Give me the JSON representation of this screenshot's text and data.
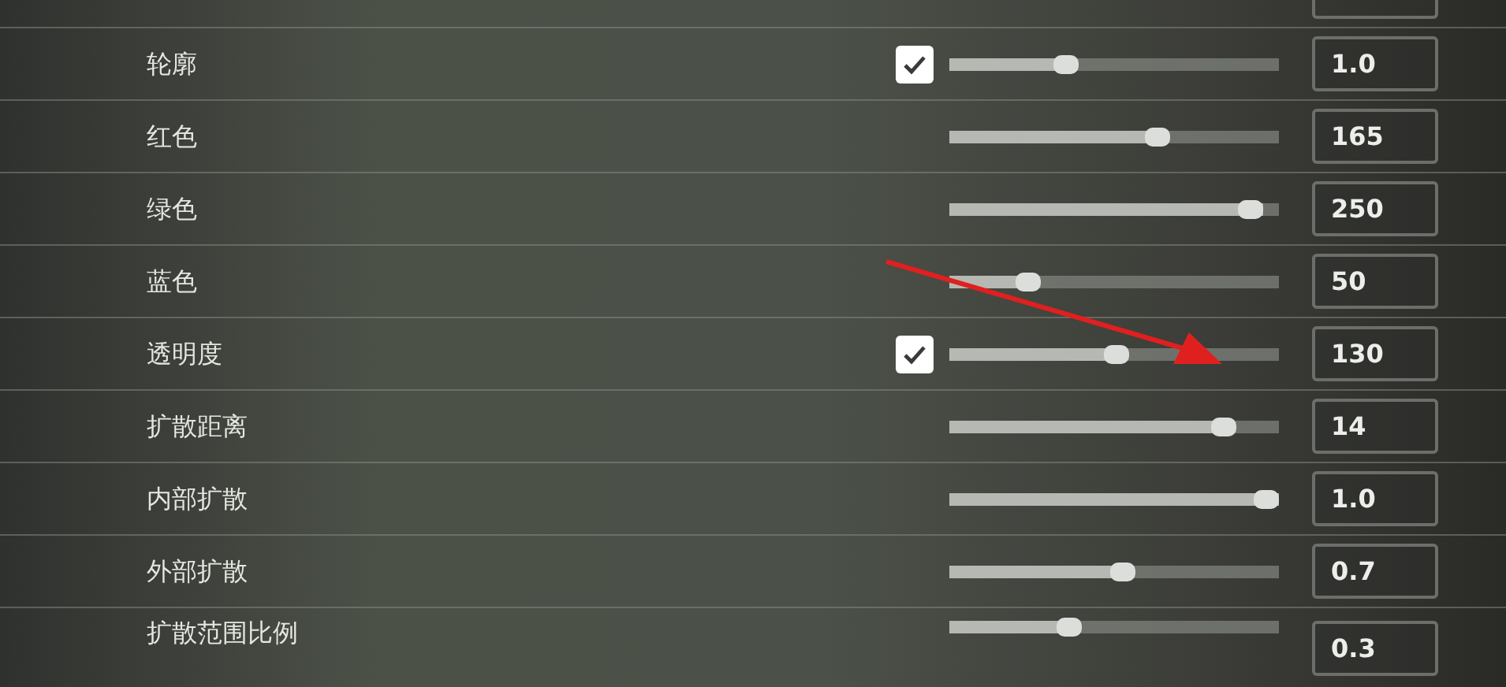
{
  "rows": [
    {
      "kind": "checkbox-slider",
      "label": "轮廓",
      "checked": true,
      "level": 0.34,
      "value": "1.0"
    },
    {
      "kind": "slider",
      "label": "红色",
      "level": 0.64,
      "value": "165"
    },
    {
      "kind": "slider",
      "label": "绿色",
      "level": 0.95,
      "value": "250"
    },
    {
      "kind": "slider",
      "label": "蓝色",
      "level": 0.22,
      "value": "50"
    },
    {
      "kind": "checkbox-slider",
      "label": "透明度",
      "checked": true,
      "level": 0.51,
      "value": "130"
    },
    {
      "kind": "slider",
      "label": "扩散距离",
      "level": 0.86,
      "value": "14"
    },
    {
      "kind": "slider",
      "label": "内部扩散",
      "level": 1.0,
      "value": "1.0"
    },
    {
      "kind": "slider",
      "label": "外部扩散",
      "level": 0.53,
      "value": "0.7"
    },
    {
      "kind": "slider",
      "label": "扩散范围比例",
      "level": 0.35,
      "value": "0.3"
    }
  ]
}
